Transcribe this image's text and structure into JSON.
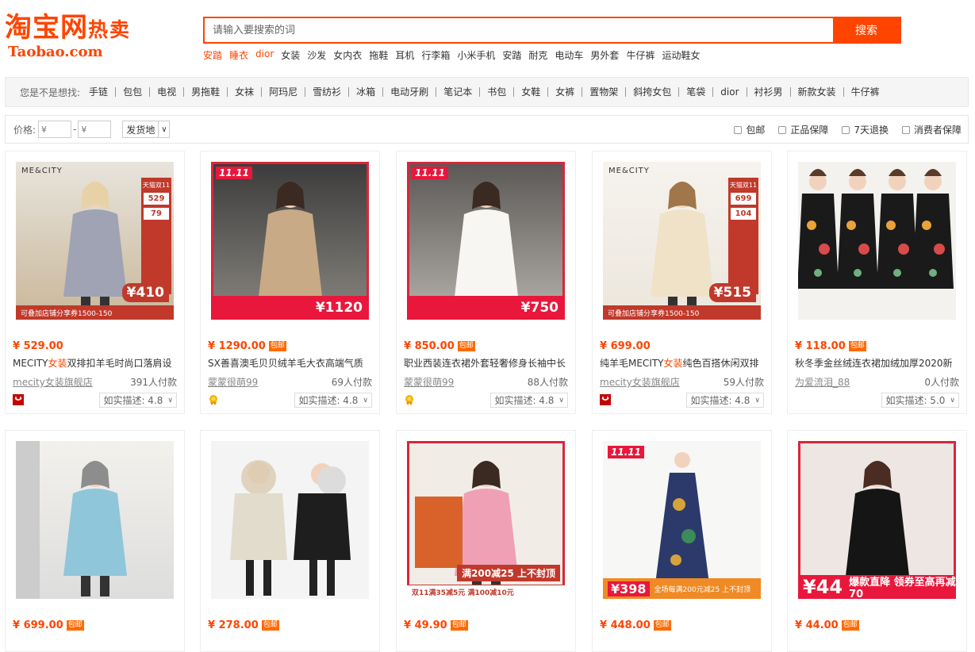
{
  "header": {
    "logo_main": "淘宝网",
    "logo_sub_text": "热卖",
    "logo_domain": "Taobao.com",
    "search_placeholder": "请输入要搜索的词",
    "search_button": "搜索",
    "hot_words": [
      {
        "label": "安踏",
        "highlight": true
      },
      {
        "label": "睡衣",
        "highlight": true
      },
      {
        "label": "dior",
        "highlight": true
      },
      {
        "label": "女装",
        "highlight": false
      },
      {
        "label": "沙发",
        "highlight": false
      },
      {
        "label": "女内衣",
        "highlight": false
      },
      {
        "label": "拖鞋",
        "highlight": false
      },
      {
        "label": "耳机",
        "highlight": false
      },
      {
        "label": "行李箱",
        "highlight": false
      },
      {
        "label": "小米手机",
        "highlight": false
      },
      {
        "label": "安踏",
        "highlight": false
      },
      {
        "label": "耐克",
        "highlight": false
      },
      {
        "label": "电动车",
        "highlight": false
      },
      {
        "label": "男外套",
        "highlight": false
      },
      {
        "label": "牛仔裤",
        "highlight": false
      },
      {
        "label": "运动鞋女",
        "highlight": false
      }
    ]
  },
  "suggest": {
    "lead": "您是不是想找:",
    "keywords": [
      "手链",
      "包包",
      "电视",
      "男拖鞋",
      "女袜",
      "阿玛尼",
      "雪纺衫",
      "冰箱",
      "电动牙刷",
      "笔记本",
      "书包",
      "女鞋",
      "女裤",
      "置物架",
      "斜挎女包",
      "笔袋",
      "dior",
      "衬衫男",
      "新款女装",
      "牛仔裤"
    ]
  },
  "filter": {
    "price_label": "价格:",
    "price_min_placeholder": "¥",
    "price_max_placeholder": "¥",
    "dash": "-",
    "location": "发货地",
    "checks": [
      "包邮",
      "正品保障",
      "7天退换",
      "消费者保障"
    ]
  },
  "products": [
    {
      "price": "¥ 529.00",
      "baoyou": false,
      "title_pre": "MECITY",
      "title_hl": "女装",
      "title_post": "双排扣羊毛时尚口落肩设",
      "shop": "mecity女装旗舰店",
      "sold": "391人付款",
      "rating": "如实描述: 4.8",
      "badge": "tmall",
      "img_style": "mecity-grey",
      "img_price": "410",
      "img_side_price": "529",
      "img_side_price2": "79",
      "img_band": "可叠加店铺分享券1500-150"
    },
    {
      "price": "¥ 1290.00",
      "baoyou": true,
      "title_pre": "SX善喜澳毛贝贝绒羊毛大衣高端气质",
      "title_hl": "",
      "title_post": "",
      "shop": "蒙蒙很萌99",
      "sold": "69人付款",
      "rating": "如实描述: 4.8",
      "badge": "gold",
      "img_style": "1111-camel",
      "img_price": "1120",
      "img_band": ""
    },
    {
      "price": "¥ 850.00",
      "baoyou": true,
      "title_pre": "职业西装连衣裙外套轻奢修身长袖中长",
      "title_hl": "",
      "title_post": "",
      "shop": "蒙蒙很萌99",
      "sold": "88人付款",
      "rating": "如实描述: 4.8",
      "badge": "gold",
      "img_style": "1111-white",
      "img_price": "750",
      "img_band": ""
    },
    {
      "price": "¥ 699.00",
      "baoyou": false,
      "title_pre": "纯羊毛MECITY",
      "title_hl": "女装",
      "title_post": "纯色百搭休闲双排",
      "shop": "mecity女装旗舰店",
      "sold": "59人付款",
      "rating": "如实描述: 4.8",
      "badge": "tmall",
      "img_style": "mecity-cream",
      "img_price": "515",
      "img_side_price": "699",
      "img_side_price2": "104",
      "img_band": "可叠加店铺分享券1500-150"
    },
    {
      "price": "¥ 118.00",
      "baoyou": true,
      "title_pre": "秋冬季金丝绒连衣裙加绒加厚2020新",
      "title_hl": "",
      "title_post": "",
      "shop": "为爱流泪_88",
      "sold": "0人付款",
      "rating": "如实描述: 5.0",
      "badge": "none",
      "img_style": "floral",
      "img_price": "",
      "img_band": ""
    },
    {
      "price": "¥ 699.00",
      "baoyou": true,
      "img_style": "blue-coat"
    },
    {
      "price": "¥ 278.00",
      "baoyou": true,
      "img_style": "parka"
    },
    {
      "price": "¥ 49.90",
      "baoyou": true,
      "img_style": "sweater",
      "img_band": "双11满35减5元 满100减10元",
      "img_promo": "满200减25 上不封顶"
    },
    {
      "price": "¥ 448.00",
      "baoyou": true,
      "img_style": "long-dress",
      "img_price": "398",
      "img_band": "全场每满200元减25 上不封顶"
    },
    {
      "price": "¥ 44.00",
      "baoyou": true,
      "img_style": "lace",
      "img_price": "44",
      "img_band": "爆款直降 领券至高再减70"
    }
  ],
  "baoyou_label": "包邮",
  "colors": {
    "accent": "#ff4400",
    "tmall_red": "#c0392b",
    "pink": "#e8173b"
  }
}
